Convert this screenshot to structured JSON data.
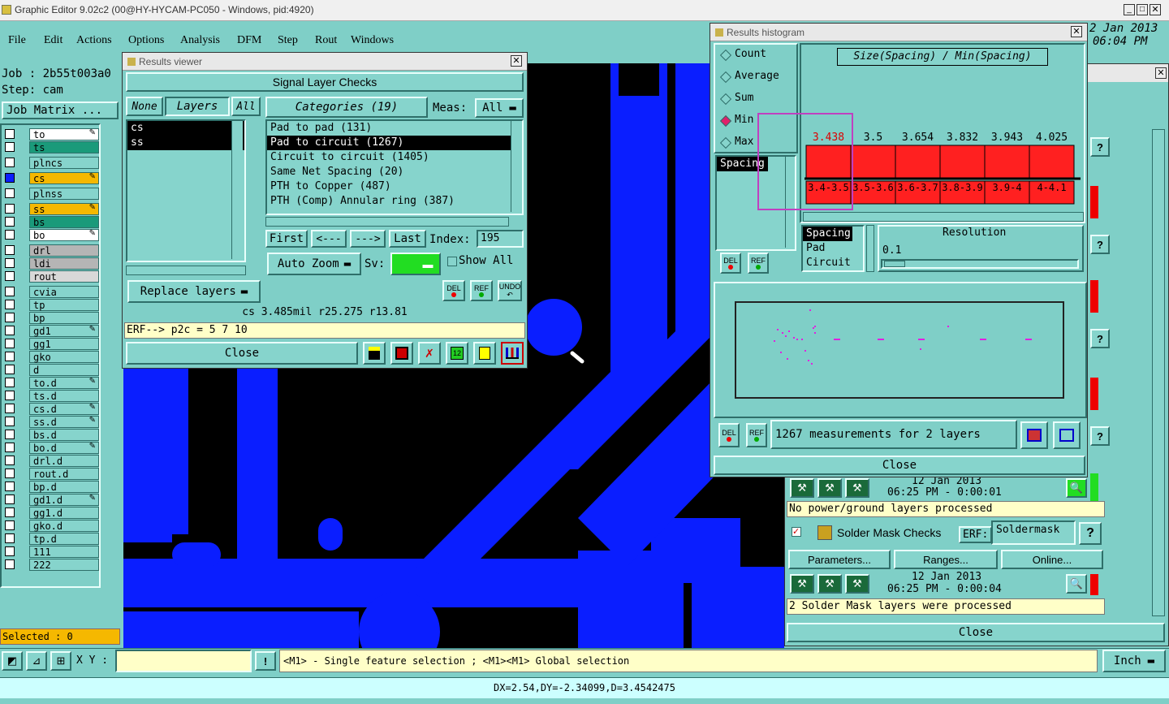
{
  "app": {
    "title": "Graphic Editor 9.02c2 (00@HY-HYCAM-PC050 - Windows, pid:4920)",
    "date": "2 Jan 2013",
    "time": "06:04 PM"
  },
  "menu": [
    "File",
    "Edit",
    "Actions",
    "Options",
    "Analysis",
    "DFM",
    "Step",
    "Rout",
    "Windows"
  ],
  "job": {
    "job_label": "Job : 2b55t003a0",
    "step_label": "Step: cam",
    "matrix_button": "Job Matrix ..."
  },
  "layers": [
    "to",
    "ts",
    "plncs",
    "cs",
    "plnss",
    "ss",
    "bs",
    "bo",
    "drl",
    "ldi",
    "rout",
    "cvia",
    "tp",
    "bp",
    "gd1",
    "gg1",
    "gko",
    "d",
    "to.d",
    "ts.d",
    "cs.d",
    "ss.d",
    "bs.d",
    "bo.d",
    "drl.d",
    "rout.d",
    "bp.d",
    "gd1.d",
    "gg1.d",
    "gko.d",
    "tp.d",
    "111",
    "222"
  ],
  "selected": "Selected : 0",
  "results_viewer": {
    "title": "Results viewer",
    "header": "Signal Layer Checks",
    "none": "None",
    "layers": "Layers",
    "all": "All",
    "categories": "Categories (19)",
    "meas_label": "Meas:",
    "meas_value": "All",
    "layer_items": [
      "cs",
      "ss"
    ],
    "category_items": [
      "Pad to pad (131)",
      "Pad to circuit (1267)",
      "Circuit to circuit (1405)",
      "Same Net Spacing (20)",
      "PTH to Copper (487)",
      "PTH (Comp) Annular ring (387)"
    ],
    "first": "First",
    "prev": "<---",
    "next": "--->",
    "last": "Last",
    "index_label": "Index:",
    "index_value": "195",
    "auto_zoom": "Auto Zoom",
    "sv_label": "Sv:",
    "show_all": "Show All",
    "replace_layers": "Replace layers",
    "del": "DEL",
    "ref": "REF",
    "undo": "UNDO",
    "status1": "cs 3.485mil  r25.275  r13.81",
    "status2": "ERF--> p2c = 5 7 10",
    "close": "Close"
  },
  "histogram": {
    "title": "Results histogram",
    "modes": [
      "Count",
      "Average",
      "Sum",
      "Min",
      "Max"
    ],
    "selected_mode": "Min",
    "chart_title": "Size(Spacing) / Min(Spacing)",
    "list_left": [
      "Spacing"
    ],
    "list_right": [
      "Spacing",
      "Pad",
      "Circuit"
    ],
    "resolution_label": "Resolution",
    "resolution_value": "0.1",
    "summary": "1267 measurements for 2 layers",
    "close": "Close",
    "del": "DEL",
    "ref": "REF"
  },
  "chart_data": {
    "type": "bar",
    "title": "Size(Spacing) / Min(Spacing)",
    "categories": [
      "3.4-3.5",
      "3.5-3.6",
      "3.6-3.7",
      "3.8-3.9",
      "3.9-4",
      "4-4.1"
    ],
    "values": [
      3.438,
      3.5,
      3.654,
      3.832,
      3.943,
      4.025
    ],
    "value_labels": [
      "3.438",
      "3.5",
      "3.654",
      "3.832",
      "3.943",
      "4.025"
    ],
    "highlight_color": "#ff2020"
  },
  "drc": {
    "time1_date": "12 Jan 2013",
    "time1": "06:25 PM - 0:00:01",
    "msg1": "No power/ground layers processed",
    "solder_title": "Solder Mask Checks",
    "erf_label": "ERF:",
    "erf_value": "Soldermask",
    "parameters": "Parameters...",
    "ranges": "Ranges...",
    "online": "Online...",
    "time2_date": "12 Jan 2013",
    "time2": "06:25 PM - 0:00:04",
    "msg2": "2 Solder Mask layers were processed",
    "close": "Close"
  },
  "bottom": {
    "xy_label": "X Y :",
    "hint": "<M1> - Single feature selection ; <M1><M1> Global selection",
    "units": "Inch",
    "status": "DX=2.54,DY=-2.34099,D=3.4542475"
  }
}
